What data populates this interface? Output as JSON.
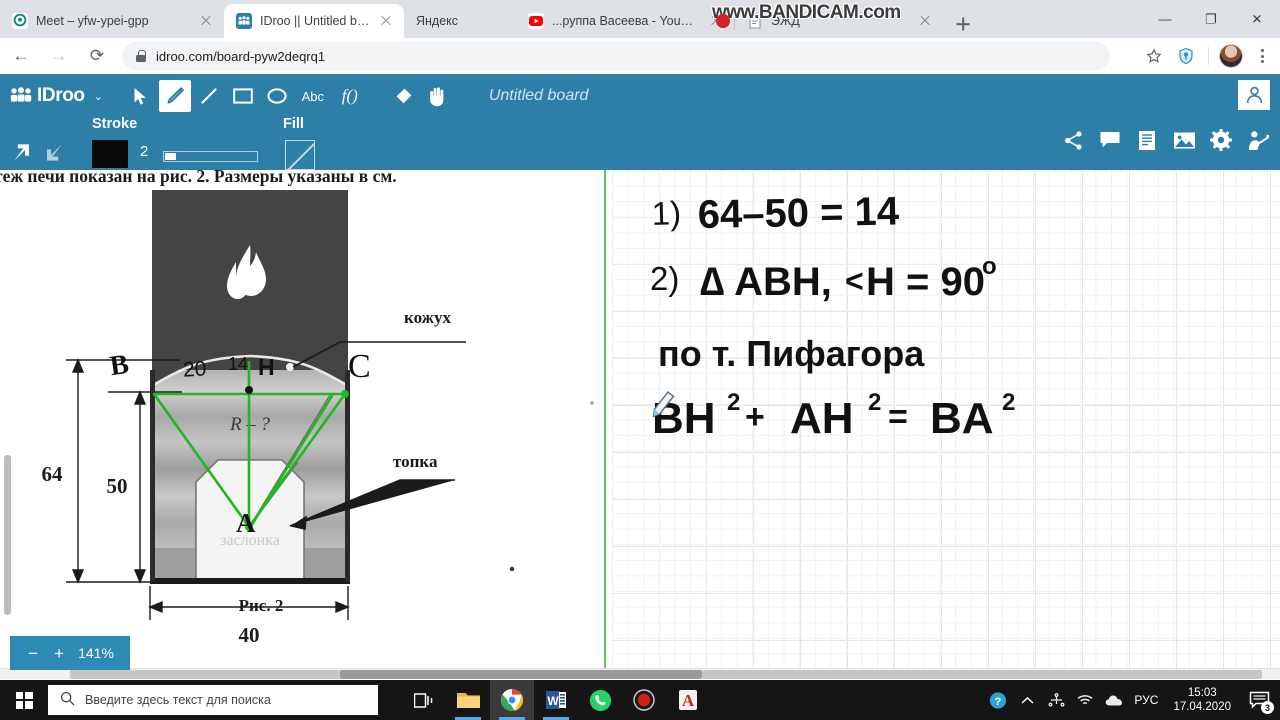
{
  "browser": {
    "tabs": [
      {
        "title": "Meet – yfw-ypei-gpp",
        "favicon": "meet-icon",
        "active": false
      },
      {
        "title": "IDroo || Untitled board",
        "favicon": "idroo-icon",
        "active": true
      },
      {
        "title": "Яндекс",
        "favicon": "yandex-icon",
        "active": false
      },
      {
        "title": "...руппа Васеева - YouTub",
        "favicon": "youtube-icon",
        "active": false
      },
      {
        "title": "ЭЖД",
        "favicon": "document-icon",
        "active": false
      }
    ],
    "new_tab_label": "+",
    "window_controls": {
      "minimize": "—",
      "maximize": "❐",
      "close": "✕"
    },
    "nav": {
      "back": "←",
      "forward": "→",
      "reload": "⟳"
    },
    "address": {
      "url": "idroo.com/board-pyw2deqrq1",
      "lock": "lock-icon"
    },
    "omnibox_icons": [
      "star-icon",
      "shield-icon",
      "avatar",
      "kebab-menu"
    ]
  },
  "watermark": {
    "text_pre": "www.",
    "text_brand": "BANDICAM",
    "text_post": ".com"
  },
  "idroo": {
    "brand": "IDroo",
    "brand_caret": "⌄",
    "board_title": "Untitled board",
    "tools": [
      {
        "name": "select-tool",
        "glyph": "➤",
        "active": false
      },
      {
        "name": "pencil-tool",
        "glyph": "✎",
        "active": true
      },
      {
        "name": "line-tool",
        "glyph": "/",
        "active": false
      },
      {
        "name": "rectangle-tool",
        "glyph": "▭",
        "active": false
      },
      {
        "name": "ellipse-tool",
        "glyph": "◯",
        "active": false
      },
      {
        "name": "text-tool",
        "glyph": "Abc",
        "active": false
      },
      {
        "name": "formula-tool",
        "glyph": "f()",
        "active": false
      },
      {
        "name": "eraser-tool",
        "glyph": "◆",
        "active": false
      },
      {
        "name": "pan-tool",
        "glyph": "✋",
        "active": false
      }
    ],
    "properties": {
      "stroke_label": "Stroke",
      "fill_label": "Fill",
      "stroke_color": "#0a0a0a",
      "stroke_width": "2",
      "fill_color": "transparent"
    },
    "undo_label": "undo",
    "redo_label": "redo",
    "right_icons": [
      "share-icon",
      "chat-icon",
      "document-icon",
      "image-icon",
      "settings-icon",
      "presenter-icon"
    ],
    "zoom": {
      "minus": "−",
      "plus": "+",
      "level": "141%"
    }
  },
  "board": {
    "document_text": "теж печи показан на рис. 2. Размеры указаны в см.",
    "figure_caption": "Рис. 2",
    "figure_labels": {
      "kozhuh": "кожух",
      "topka": "топка",
      "radius": "R – ?",
      "dim_height_outer": "64",
      "dim_height_inner": "50",
      "dim_width": "40"
    },
    "annotations": {
      "point_b": "B",
      "point_c": "C",
      "point_h": "H",
      "point_a": "A",
      "seg_20": "20",
      "seg_14": "14"
    },
    "handwriting": {
      "line1": "1) 64–50 = 14",
      "line2": "2) ∆ ABH,  <H = 90°",
      "line3": "по т. Пифагора",
      "line4": "BH² + AH² = BA²"
    }
  },
  "taskbar": {
    "search_placeholder": "Введите здесь текст для поиска",
    "apps": [
      {
        "name": "task-view",
        "glyph": "taskview-icon"
      },
      {
        "name": "file-explorer",
        "glyph": "folder-icon"
      },
      {
        "name": "chrome",
        "glyph": "chrome-icon"
      },
      {
        "name": "word",
        "glyph": "word-icon"
      },
      {
        "name": "whatsapp",
        "glyph": "whatsapp-icon"
      },
      {
        "name": "bandicam",
        "glyph": "record-icon"
      },
      {
        "name": "adobe-reader",
        "glyph": "pdf-icon"
      }
    ],
    "tray": {
      "help": "?",
      "chevron": "︿",
      "language": "РУС",
      "time": "15:03",
      "date": "17.04.2020",
      "notification_count": "3"
    }
  }
}
